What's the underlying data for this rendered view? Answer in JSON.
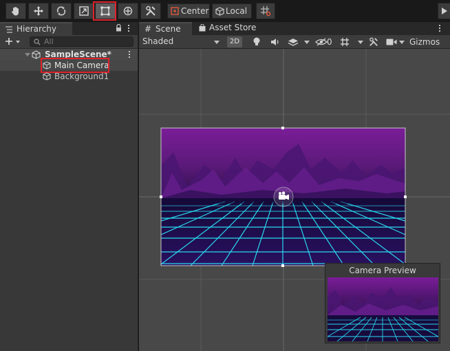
{
  "toolbar": {
    "tools": [
      "hand-tool",
      "move-tool",
      "rotate-tool",
      "scale-tool",
      "rect-tool",
      "transform-tool",
      "custom-editor-tool"
    ],
    "active_tool": "rect-tool",
    "pivot_label": "Center",
    "space_label": "Local"
  },
  "hierarchy": {
    "tab_label": "Hierarchy",
    "search_placeholder": "All",
    "scene_name": "SampleScene*",
    "items": [
      {
        "label": "Main Camera",
        "selected": true
      },
      {
        "label": "Background1",
        "selected": false
      }
    ]
  },
  "scene_view": {
    "tabs": [
      {
        "label": "Scene",
        "active": true
      },
      {
        "label": "Asset Store",
        "active": false
      }
    ],
    "shading_mode": "Shaded",
    "mode_2d_label": "2D",
    "hidden_objects_count": "0",
    "gizmos_label": "Gizmos"
  },
  "camera_preview": {
    "title": "Camera Preview"
  },
  "colors": {
    "selection_highlight": "#e0232b",
    "sky_top": "#6d1a8a",
    "grid_neon": "#26d7ef",
    "editor_bg": "#484848"
  }
}
